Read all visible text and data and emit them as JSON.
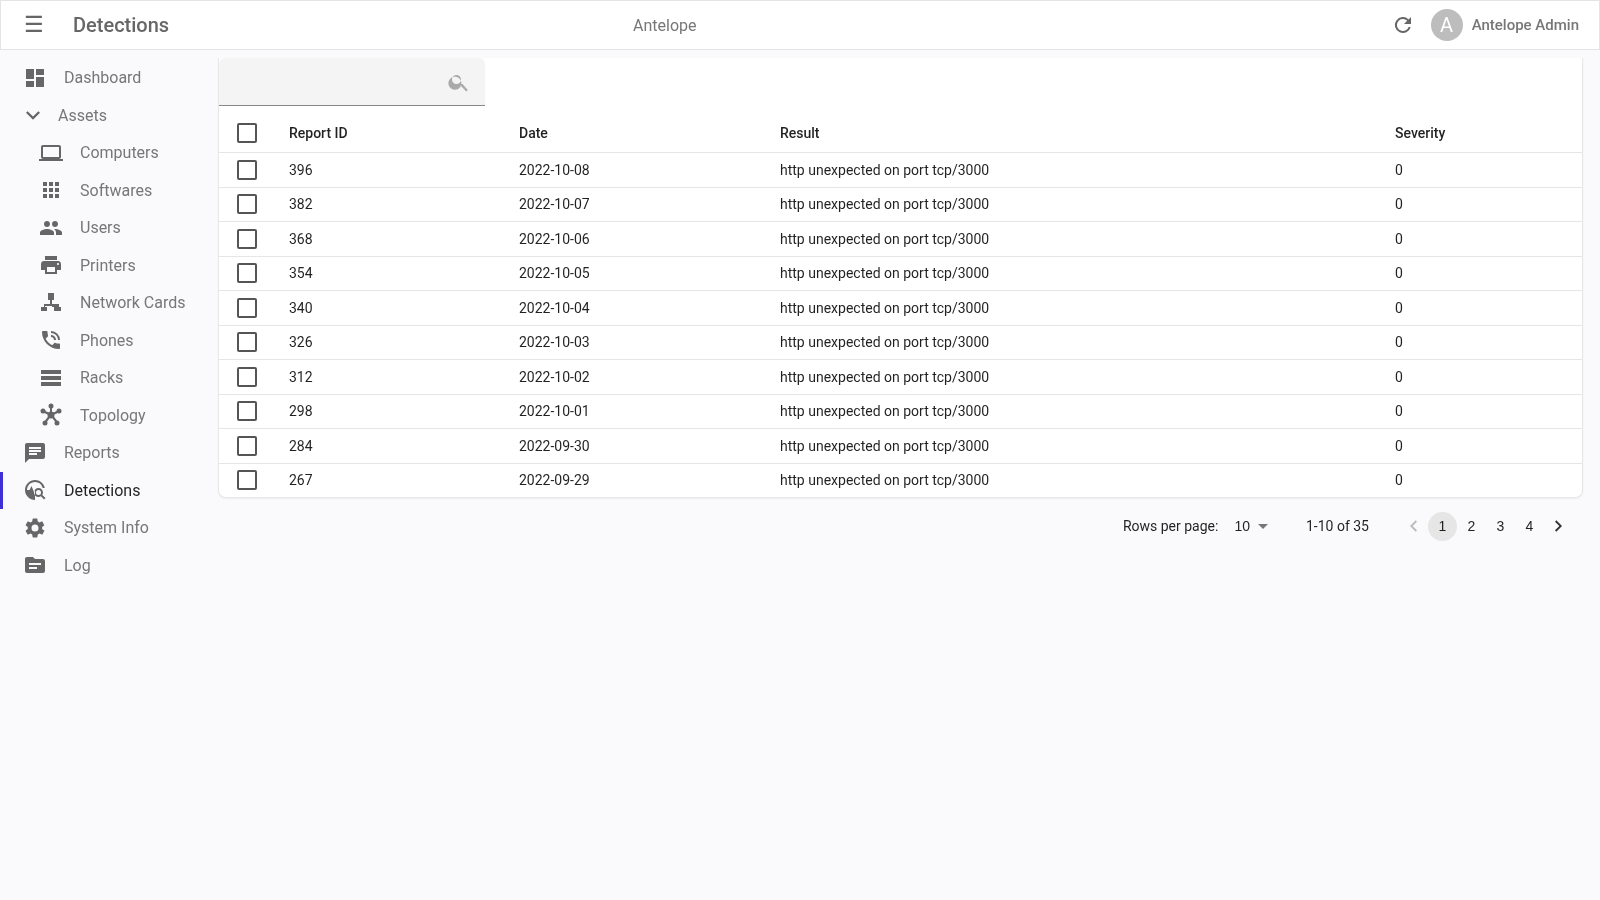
{
  "app_bar": {
    "menu_glyph": "☰",
    "title": "Detections",
    "app_name": "Antelope",
    "avatar_letter": "A",
    "user_name": "Antelope Admin"
  },
  "sidebar": {
    "items": [
      {
        "label": "Dashboard",
        "selected": false
      },
      {
        "label": "Assets",
        "selected": false,
        "expanded": true,
        "children": [
          {
            "label": "Computers",
            "selected": false
          },
          {
            "label": "Softwares",
            "selected": false
          },
          {
            "label": "Users",
            "selected": false
          },
          {
            "label": "Printers",
            "selected": false
          },
          {
            "label": "Network Cards",
            "selected": false
          },
          {
            "label": "Phones",
            "selected": false
          },
          {
            "label": "Racks",
            "selected": false
          },
          {
            "label": "Topology",
            "selected": false
          }
        ]
      },
      {
        "label": "Reports",
        "selected": false
      },
      {
        "label": "Detections",
        "selected": true
      },
      {
        "label": "System Info",
        "selected": false
      },
      {
        "label": "Log",
        "selected": false
      }
    ]
  },
  "table": {
    "all_checked": false,
    "columns": [
      "Report ID",
      "Date",
      "Result",
      "Severity"
    ],
    "rows": [
      {
        "checked": false,
        "cells": [
          "396",
          "2022-10-08",
          "http unexpected on port tcp/3000",
          "0"
        ]
      },
      {
        "checked": false,
        "cells": [
          "382",
          "2022-10-07",
          "http unexpected on port tcp/3000",
          "0"
        ]
      },
      {
        "checked": false,
        "cells": [
          "368",
          "2022-10-06",
          "http unexpected on port tcp/3000",
          "0"
        ]
      },
      {
        "checked": false,
        "cells": [
          "354",
          "2022-10-05",
          "http unexpected on port tcp/3000",
          "0"
        ]
      },
      {
        "checked": false,
        "cells": [
          "340",
          "2022-10-04",
          "http unexpected on port tcp/3000",
          "0"
        ]
      },
      {
        "checked": false,
        "cells": [
          "326",
          "2022-10-03",
          "http unexpected on port tcp/3000",
          "0"
        ]
      },
      {
        "checked": false,
        "cells": [
          "312",
          "2022-10-02",
          "http unexpected on port tcp/3000",
          "0"
        ]
      },
      {
        "checked": false,
        "cells": [
          "298",
          "2022-10-01",
          "http unexpected on port tcp/3000",
          "0"
        ]
      },
      {
        "checked": false,
        "cells": [
          "284",
          "2022-09-30",
          "http unexpected on port tcp/3000",
          "0"
        ]
      },
      {
        "checked": false,
        "cells": [
          "267",
          "2022-09-29",
          "http unexpected on port tcp/3000",
          "0"
        ]
      }
    ]
  },
  "pagination": {
    "rows_label": "Rows per page:",
    "rows_value": "10",
    "range": "1-10 of 35",
    "prev_disabled": true,
    "next_disabled": false,
    "pages": [
      {
        "label": "1",
        "selected": true
      },
      {
        "label": "2",
        "selected": false
      },
      {
        "label": "3",
        "selected": false
      },
      {
        "label": "4",
        "selected": false
      }
    ]
  }
}
